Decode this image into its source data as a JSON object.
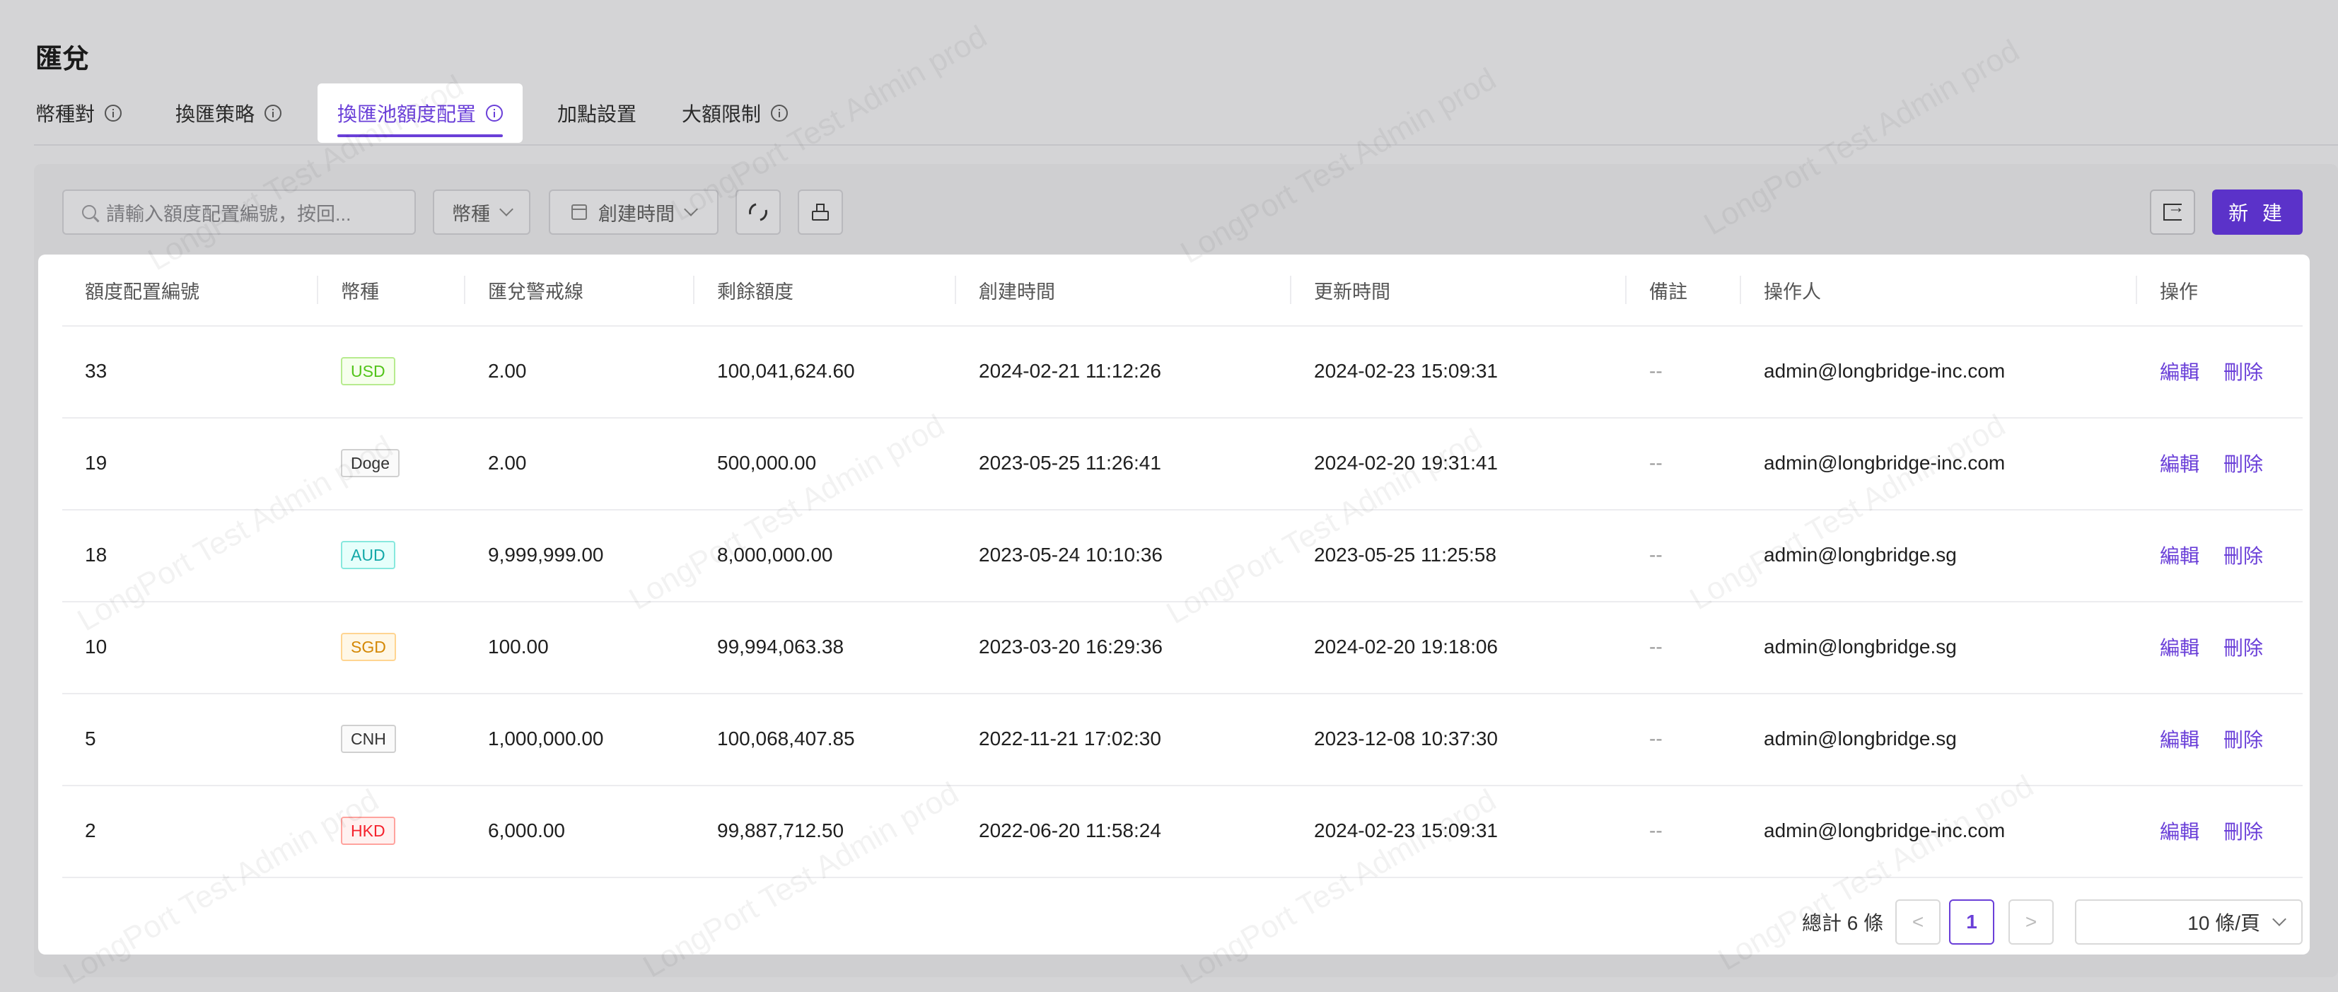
{
  "page": {
    "title": "匯兌"
  },
  "tabs": [
    {
      "label": "幣種對",
      "info": true,
      "active": false
    },
    {
      "label": "換匯策略",
      "info": true,
      "active": false
    },
    {
      "label": "換匯池額度配置",
      "info": true,
      "active": true
    },
    {
      "label": "加點設置",
      "info": false,
      "active": false
    },
    {
      "label": "大額限制",
      "info": true,
      "active": false
    }
  ],
  "toolbar": {
    "search_placeholder": "請輸入額度配置編號，按回...",
    "currency_select": "幣種",
    "created_time_select": "創建時間",
    "new_label": "新 建",
    "refresh_icon": "refresh-icon",
    "clear_icon": "clear-icon",
    "export_icon": "export-icon"
  },
  "table": {
    "columns": [
      "額度配置編號",
      "幣種",
      "匯兌警戒線",
      "剩餘額度",
      "創建時間",
      "更新時間",
      "備註",
      "操作人",
      "操作"
    ],
    "rows": [
      {
        "id": "33",
        "currency": "USD",
        "tag": "green",
        "alert": "2.00",
        "remaining": "100,041,624.60",
        "created": "2024-02-21 11:12:26",
        "updated": "2024-02-23 15:09:31",
        "remark": "--",
        "operator": "admin@longbridge-inc.com"
      },
      {
        "id": "19",
        "currency": "Doge",
        "tag": "default",
        "alert": "2.00",
        "remaining": "500,000.00",
        "created": "2023-05-25 11:26:41",
        "updated": "2024-02-20 19:31:41",
        "remark": "--",
        "operator": "admin@longbridge-inc.com"
      },
      {
        "id": "18",
        "currency": "AUD",
        "tag": "cyan",
        "alert": "9,999,999.00",
        "remaining": "8,000,000.00",
        "created": "2023-05-24 10:10:36",
        "updated": "2023-05-25 11:25:58",
        "remark": "--",
        "operator": "admin@longbridge.sg"
      },
      {
        "id": "10",
        "currency": "SGD",
        "tag": "gold",
        "alert": "100.00",
        "remaining": "99,994,063.38",
        "created": "2023-03-20 16:29:36",
        "updated": "2024-02-20 19:18:06",
        "remark": "--",
        "operator": "admin@longbridge.sg"
      },
      {
        "id": "5",
        "currency": "CNH",
        "tag": "default",
        "alert": "1,000,000.00",
        "remaining": "100,068,407.85",
        "created": "2022-11-21 17:02:30",
        "updated": "2023-12-08 10:37:30",
        "remark": "--",
        "operator": "admin@longbridge.sg"
      },
      {
        "id": "2",
        "currency": "HKD",
        "tag": "red",
        "alert": "6,000.00",
        "remaining": "99,887,712.50",
        "created": "2022-06-20 11:58:24",
        "updated": "2024-02-23 15:09:31",
        "remark": "--",
        "operator": "admin@longbridge-inc.com"
      }
    ],
    "actions": {
      "edit": "編輯",
      "delete": "刪除"
    }
  },
  "pagination": {
    "total_text": "總計 6 條",
    "current_page": "1",
    "page_size": "10 條/頁",
    "prev": "<",
    "next": ">"
  },
  "watermark": "LongPort Test Admin prod",
  "colors": {
    "accent": "#6a3fd8",
    "primary_button": "#5b32c9"
  }
}
